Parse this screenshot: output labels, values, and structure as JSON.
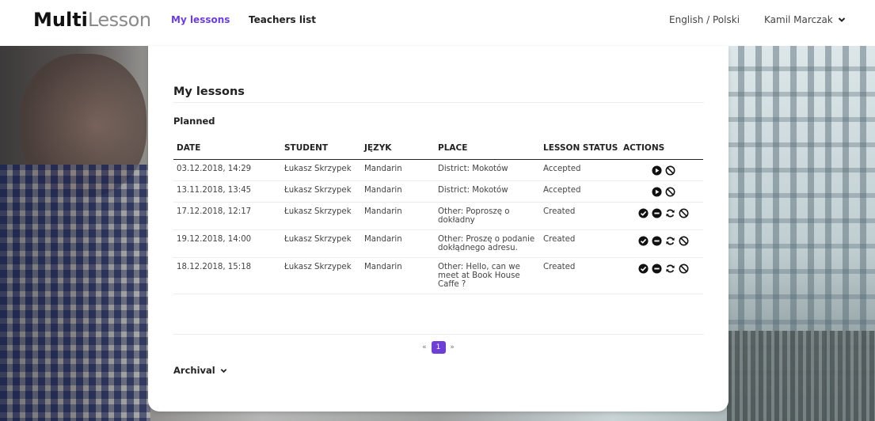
{
  "header": {
    "logo_bold": "Multi",
    "logo_light": "Lesson",
    "nav": [
      {
        "label": "My lessons"
      },
      {
        "label": "Teachers list"
      }
    ],
    "language": "English / Polski",
    "user_name": "Kamil Marczak"
  },
  "colors": {
    "accent": "#6d3fd8"
  },
  "main": {
    "title": "My lessons",
    "section_planned": "Planned",
    "columns": [
      "DATE",
      "STUDENT",
      "JĘZYK",
      "PLACE",
      "LESSON STATUS",
      "ACTIONS"
    ],
    "rows": [
      {
        "date": "03.12.2018, 14:29",
        "student": "Łukasz Skrzypek",
        "language": "Mandarin",
        "place": "District: Mokotów",
        "status": "Accepted",
        "actions": [
          "play-circle-icon",
          "ban-icon"
        ]
      },
      {
        "date": "13.11.2018, 13:45",
        "student": "Łukasz Skrzypek",
        "language": "Mandarin",
        "place": "District: Mokotów",
        "status": "Accepted",
        "actions": [
          "play-circle-icon",
          "ban-icon"
        ]
      },
      {
        "date": "17.12.2018, 12:17",
        "student": "Łukasz Skrzypek",
        "language": "Mandarin",
        "place": "Other: Poproszę o dokładny",
        "status": "Created",
        "actions": [
          "check-circle-icon",
          "minus-circle-icon",
          "refresh-icon",
          "ban-icon"
        ]
      },
      {
        "date": "19.12.2018, 14:00",
        "student": "Łukasz Skrzypek",
        "language": "Mandarin",
        "place": "Other: Proszę o podanie dokłądnego adresu.",
        "status": "Created",
        "actions": [
          "check-circle-icon",
          "minus-circle-icon",
          "refresh-icon",
          "ban-icon"
        ]
      },
      {
        "date": "18.12.2018, 15:18",
        "student": "Łukasz Skrzypek",
        "language": "Mandarin",
        "place": "Other: Hello, can we meet at Book House Caffe ?",
        "status": "Created",
        "actions": [
          "check-circle-icon",
          "minus-circle-icon",
          "refresh-icon",
          "ban-icon"
        ]
      }
    ],
    "pagination": {
      "prev": "«",
      "current": "1",
      "next": "»"
    },
    "section_archival": "Archival"
  }
}
